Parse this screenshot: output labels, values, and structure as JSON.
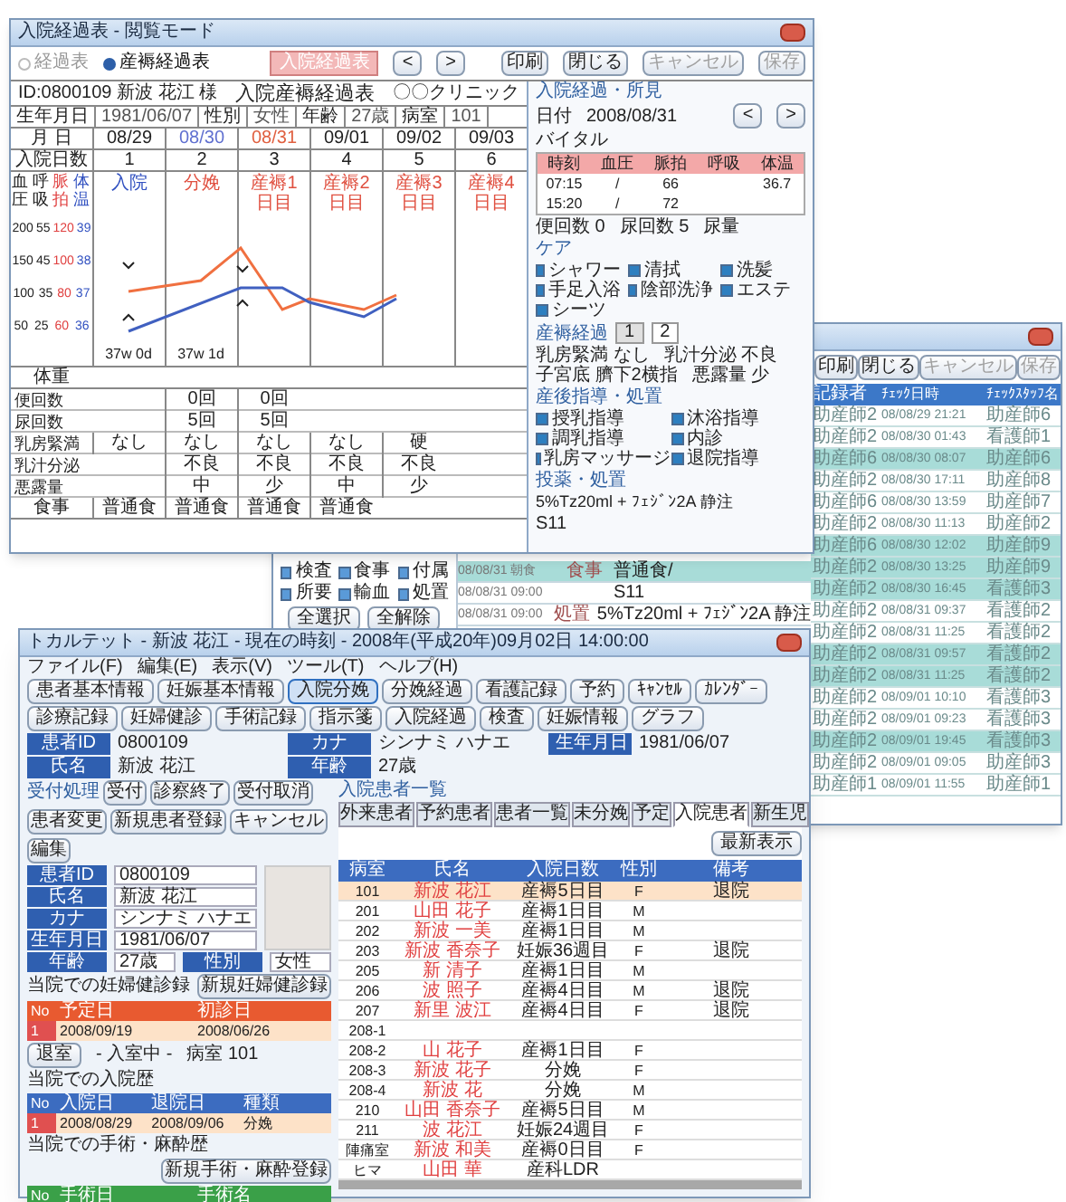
{
  "log_window": {
    "actions": [
      {
        "label": "印刷",
        "disabled": false
      },
      {
        "label": "閉じる",
        "disabled": false
      },
      {
        "label": "キャンセル",
        "disabled": true
      },
      {
        "label": "保存",
        "disabled": true
      }
    ],
    "filters": [
      {
        "label": "検査",
        "checked": true
      },
      {
        "label": "食事",
        "checked": true
      },
      {
        "label": "付属",
        "checked": true
      },
      {
        "label": "所要",
        "checked": true
      },
      {
        "label": "輸血",
        "checked": true
      },
      {
        "label": "処置",
        "checked": true
      }
    ],
    "filter_buttons": [
      "全選択",
      "全解除"
    ],
    "entries": [
      {
        "time": "08/08/31 朝食",
        "kind": "食事",
        "text": "普通食/",
        "highlighted": true
      },
      {
        "time": "08/08/31 09:00",
        "text": "S11",
        "highlighted": false
      },
      {
        "time": "08/08/31 09:00",
        "kind": "処置",
        "text": "5%Tz20ml + ﾌｪｼﾞﾝ2A 静注",
        "highlighted": false
      }
    ],
    "columns": [
      "記録者",
      "ﾁｪｯｸ日時",
      "ﾁｪｯｸｽﾀｯﾌ名"
    ],
    "rows": [
      {
        "cells": [
          "助産師2",
          "08/08/29 21:21",
          "助産師6"
        ],
        "highlighted": false
      },
      {
        "cells": [
          "助産師2",
          "08/08/30 01:43",
          "看護師1"
        ],
        "highlighted": false
      },
      {
        "cells": [
          "助産師6",
          "08/08/30 08:07",
          "助産師6"
        ],
        "highlighted": true
      },
      {
        "cells": [
          "助産師2",
          "08/08/30 17:11",
          "助産師8"
        ],
        "highlighted": false
      },
      {
        "cells": [
          "助産師6",
          "08/08/30 13:59",
          "助産師7"
        ],
        "highlighted": false
      },
      {
        "cells": [
          "助産師2",
          "08/08/30 11:13",
          "助産師2"
        ],
        "highlighted": false
      },
      {
        "cells": [
          "助産師6",
          "08/08/30 12:02",
          "助産師9"
        ],
        "highlighted": true
      },
      {
        "cells": [
          "助産師2",
          "08/08/30 13:25",
          "助産師9"
        ],
        "highlighted": true
      },
      {
        "cells": [
          "助産師2",
          "08/08/30 16:45",
          "看護師3"
        ],
        "highlighted": true
      },
      {
        "cells": [
          "助産師2",
          "08/08/31 09:37",
          "看護師2"
        ],
        "highlighted": false
      },
      {
        "cells": [
          "助産師2",
          "08/08/31 11:25",
          "看護師2"
        ],
        "highlighted": false
      },
      {
        "cells": [
          "助産師2",
          "08/08/31 09:57",
          "看護師2"
        ],
        "highlighted": true
      },
      {
        "cells": [
          "助産師2",
          "08/08/31 11:25",
          "看護師2"
        ],
        "highlighted": true
      },
      {
        "cells": [
          "助産師2",
          "08/09/01 10:10",
          "看護師3"
        ],
        "highlighted": false
      },
      {
        "cells": [
          "助産師2",
          "08/09/01 09:23",
          "看護師3"
        ],
        "highlighted": false
      },
      {
        "cells": [
          "助産師2",
          "08/09/01 19:45",
          "看護師3"
        ],
        "highlighted": true
      },
      {
        "cells": [
          "助産師2",
          "08/09/01 09:05",
          "助産師3"
        ],
        "highlighted": false
      },
      {
        "cells": [
          "助産師1",
          "08/09/01 11:55",
          "助産師1"
        ],
        "highlighted": false
      }
    ]
  },
  "chart_window": {
    "title": "入院経過表 - 閲覧モード",
    "modes": [
      {
        "label": "経過表",
        "selected": false
      },
      {
        "label": "産褥経過表",
        "selected": true
      }
    ],
    "mode_button": "入院経過表",
    "nav": [
      "<",
      ">"
    ],
    "patient": "ID:0800109 新波 花江 様",
    "sheet_title": "入院産褥経過表",
    "clinic": "〇〇クリニック",
    "info": [
      "生年月日",
      "1981/06/07",
      "性別",
      "女性",
      "年齢",
      "27歳",
      "病室",
      "101"
    ],
    "date_label": "月 日",
    "dates": [
      "08/29",
      "08/30",
      "08/31",
      "09/01",
      "09/02",
      "09/03"
    ],
    "day_label": "入院日数",
    "days": [
      "1",
      "2",
      "3",
      "4",
      "5",
      "6"
    ],
    "axis_labels": [
      "血圧",
      "呼吸",
      "脈拍",
      "体温"
    ],
    "events": [
      "入院",
      "分娩",
      "産褥1日目",
      "産褥2日目",
      "産褥3日目",
      "産褥4日目"
    ],
    "ticks": [
      [
        "200",
        "55",
        "120",
        "39"
      ],
      [
        "150",
        "45",
        "100",
        "38"
      ],
      [
        "100",
        "35",
        "80",
        "37"
      ],
      [
        "50",
        "25",
        "60",
        "36"
      ]
    ],
    "gestation": [
      "37w 0d",
      "37w 1d"
    ],
    "weight_label": "体重",
    "obs": [
      {
        "label": "便回数",
        "cells": [
          null,
          "0回",
          "0回",
          null,
          null,
          null
        ]
      },
      {
        "label": "尿回数",
        "cells": [
          null,
          "5回",
          "5回",
          null,
          null,
          null
        ]
      },
      {
        "label": "乳房緊満",
        "cells": [
          "なし",
          "なし",
          "なし",
          "なし",
          "硬",
          null
        ]
      },
      {
        "label": "乳汁分泌",
        "cells": [
          null,
          "不良",
          "不良",
          "不良",
          "不良",
          null
        ]
      },
      {
        "label": "悪露量",
        "cells": [
          null,
          "中",
          "少",
          "中",
          "少",
          null
        ]
      }
    ],
    "meal_label": "食事",
    "meals": [
      "普通食",
      "普通食",
      "普通食",
      "普通食"
    ],
    "actions": [
      {
        "label": "印刷",
        "disabled": false
      },
      {
        "label": "閉じる",
        "disabled": false
      },
      {
        "label": "キャンセル",
        "disabled": true
      },
      {
        "label": "保存",
        "disabled": true
      }
    ],
    "findings": {
      "title": "入院経過・所見",
      "date_label": "日付",
      "date": "2008/08/31",
      "nav": [
        "<",
        ">"
      ],
      "vitals_label": "バイタル",
      "vitals_columns": [
        "時刻",
        "血圧",
        "脈拍",
        "呼吸",
        "体温"
      ],
      "vitals": [
        {
          "time": "07:15",
          "bp": "/",
          "pulse": "66",
          "temp": "36.7"
        },
        {
          "time": "15:20",
          "bp": "/",
          "pulse": "72"
        }
      ],
      "counts": [
        "便回数 0",
        "尿回数 5",
        "尿量"
      ],
      "care_label": "ケア",
      "care": [
        {
          "label": "シャワー",
          "checked": true
        },
        {
          "label": "清拭",
          "checked": true
        },
        {
          "label": "洗髪",
          "checked": true
        },
        {
          "label": "手足入浴",
          "checked": true
        },
        {
          "label": "陰部洗浄",
          "checked": true
        },
        {
          "label": "エステ",
          "checked": true
        },
        {
          "label": "シーツ",
          "checked": true
        }
      ],
      "course_label": "産褥経過",
      "course_tabs": [
        {
          "label": "1",
          "selected": false
        },
        {
          "label": "2",
          "selected": true
        }
      ],
      "course_fields": [
        "乳房緊満 なし",
        "乳汁分泌 不良",
        "子宮底 臍下2横指",
        "悪露量 少"
      ],
      "guidance_label": "産後指導・処置",
      "guidance": [
        {
          "label": "授乳指導",
          "checked": true
        },
        {
          "label": "沐浴指導",
          "checked": true
        },
        {
          "label": "調乳指導",
          "checked": true
        },
        {
          "label": "内診",
          "checked": true
        },
        {
          "label": "乳房マッサージ",
          "checked": true
        },
        {
          "label": "退院指導",
          "checked": true
        }
      ],
      "meds_label": "投薬・処置",
      "meds": "5%Tz20ml + ﾌｪｼﾞﾝ2A 静注",
      "note": "S11"
    }
  },
  "main_window": {
    "title": "トカルテット - 新波 花江 - 現在の時刻 - 2008年(平成20年)09月02日 14:00:00",
    "menu": [
      "ファイル(F)",
      "編集(E)",
      "表示(V)",
      "ツール(T)",
      "ヘルプ(H)"
    ],
    "toolbar": [
      [
        "患者基本情報",
        "妊娠基本情報",
        "入院分娩",
        "分娩経過",
        "看護記録",
        "予約",
        "ｷｬﾝｾﾙ",
        "ｶﾚﾝﾀﾞｰ"
      ],
      [
        "診療記録",
        "妊婦健診",
        "手術記録",
        "指示箋",
        "入院経過",
        "検査",
        "妊娠情報",
        "グラフ"
      ]
    ],
    "patient": [
      [
        "患者ID",
        "0800109"
      ],
      [
        "カナ",
        "シンナミ ハナエ"
      ],
      [
        "生年月日",
        "1981/06/07"
      ],
      [
        "氏名",
        "新波 花江"
      ],
      [
        "年齢",
        "27歳"
      ]
    ],
    "reception_label": "受付処理",
    "reception_buttons": [
      "受付",
      "診察終了",
      "受付取消",
      "患者変更",
      "新規患者登録",
      "キャンセル",
      "編集"
    ],
    "form": [
      [
        "患者ID",
        "0800109"
      ],
      [
        "氏名",
        "新波 花江"
      ],
      [
        "カナ",
        "シンナミ ハナエ"
      ],
      [
        "生年月日",
        "1981/06/07"
      ],
      [
        "年齢",
        "27歳"
      ],
      [
        "性別",
        "女性"
      ]
    ],
    "pregnancy_label": "当院での妊婦健診録",
    "pregnancy_button": "新規妊婦健診録",
    "pregnancy_columns": [
      "No",
      "予定日",
      "初診日"
    ],
    "pregnancy_rows": [
      [
        "1",
        "2008/09/19",
        "2008/06/26"
      ]
    ],
    "room_label": "- 入室中 -",
    "room": "病室 101",
    "exit_button": "退室",
    "admission_label": "当院での入院歴",
    "admission_columns": [
      "No",
      "入院日",
      "退院日",
      "種類"
    ],
    "admission_rows": [
      [
        "1",
        "2008/08/29",
        "2008/09/06",
        "分娩"
      ]
    ],
    "surgery_label": "当院での手術・麻酔歴",
    "surgery_button": "新規手術・麻酔登録",
    "surgery_columns": [
      "No",
      "手術日",
      "手術名"
    ],
    "list_label": "入院患者一覧",
    "tabs": [
      {
        "label": "外来患者",
        "selected": false
      },
      {
        "label": "予約患者",
        "selected": false
      },
      {
        "label": "患者一覧",
        "selected": false
      },
      {
        "label": "未分娩",
        "selected": false
      },
      {
        "label": "予定",
        "selected": false
      },
      {
        "label": "入院患者",
        "selected": true
      },
      {
        "label": "新生児",
        "selected": false
      }
    ],
    "refresh_button": "最新表示",
    "columns": [
      "病室",
      "氏名",
      "入院日数",
      "性別",
      "備考"
    ],
    "rows": [
      {
        "cells": [
          "101",
          "新波 花江",
          "産褥5日目",
          "F",
          "退院"
        ],
        "selected": true
      },
      {
        "cells": [
          "201",
          "山田 花子",
          "産褥1日目",
          "M",
          null
        ],
        "selected": false
      },
      {
        "cells": [
          "202",
          "新波 一美",
          "産褥1日目",
          "M",
          null
        ],
        "selected": false
      },
      {
        "cells": [
          "203",
          "新波 香奈子",
          "妊娠36週目",
          "F",
          "退院"
        ],
        "selected": false
      },
      {
        "cells": [
          "205",
          "新 清子",
          "産褥1日目",
          "M",
          null
        ],
        "selected": false
      },
      {
        "cells": [
          "206",
          "波 照子",
          "産褥4日目",
          "M",
          "退院"
        ],
        "selected": false
      },
      {
        "cells": [
          "207",
          "新里 波江",
          "産褥4日目",
          "F",
          "退院"
        ],
        "selected": false
      },
      {
        "cells": [
          "208-1",
          null,
          null,
          null,
          null
        ],
        "selected": false
      },
      {
        "cells": [
          "208-2",
          "山 花子",
          "産褥1日目",
          "F",
          null
        ],
        "selected": false
      },
      {
        "cells": [
          "208-3",
          "新波 花子",
          "分娩",
          "F",
          null
        ],
        "selected": false
      },
      {
        "cells": [
          "208-4",
          "新波 花",
          "分娩",
          "M",
          null
        ],
        "selected": false
      },
      {
        "cells": [
          "210",
          "山田 香奈子",
          "産褥5日目",
          "M",
          null
        ],
        "selected": false
      },
      {
        "cells": [
          "211",
          "波 花江",
          "妊娠24週目",
          "F",
          null
        ],
        "selected": false
      },
      {
        "cells": [
          "陣痛室",
          "新波 和美",
          "産褥0日目",
          "F",
          null
        ],
        "selected": false
      },
      {
        "cells": [
          "ヒマ",
          "山田 華",
          "産科LDR",
          null,
          null
        ],
        "selected": false
      }
    ]
  }
}
